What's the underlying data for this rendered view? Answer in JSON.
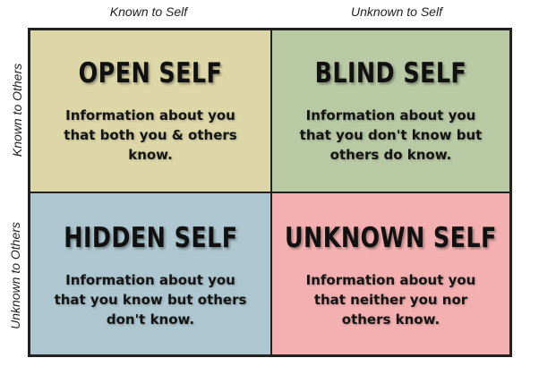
{
  "columns": {
    "left": "Known to Self",
    "right": "Unknown to Self"
  },
  "rows": {
    "top": "Known to Others",
    "bottom": "Unknown to Others"
  },
  "quadrants": {
    "open": {
      "title": "OPEN SELF",
      "description": "Information about you that both you & others know.",
      "color": "#ddd7a8"
    },
    "blind": {
      "title": "BLIND SELF",
      "description": "Information about you that you don't know but others do know.",
      "color": "#b8c9a4"
    },
    "hidden": {
      "title": "HIDDEN SELF",
      "description": "Information about you that you know but others don't know.",
      "color": "#adc6cf"
    },
    "unknown": {
      "title": "UNKNOWN SELF",
      "description": "Information about you that neither you nor others know.",
      "color": "#f4b0b0"
    }
  }
}
